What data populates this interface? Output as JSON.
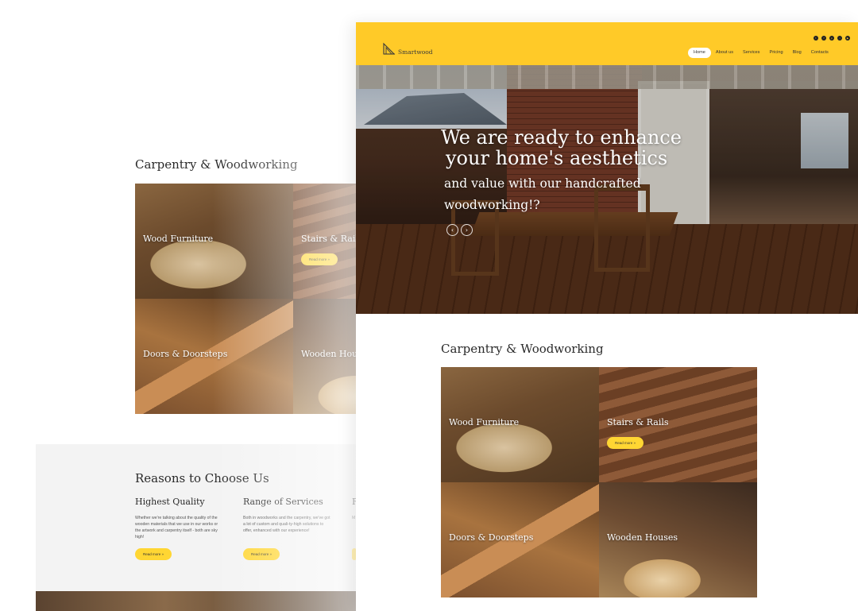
{
  "background_page": {
    "section_title": "Carpentry & Woodworking",
    "tiles": [
      {
        "label": "Wood Furniture"
      },
      {
        "label": "Stairs & Rail",
        "button": "Read more »"
      },
      {
        "label": "Doors & Doorsteps"
      },
      {
        "label": "Wooden Hou"
      }
    ],
    "reasons": {
      "title": "Reasons to Choose Us",
      "items": [
        {
          "heading": "Highest Quality",
          "text": "Whether we're talking about the quality of the wooden materials that we use in our works or the artwork and carpentry itself - both are sky high!",
          "button": "Read more »"
        },
        {
          "heading": "Range of Services",
          "text": "Both in woodworks and the carpentry, we've got a lot of custom and quali-ty-high solutions to offer, enhanced with our experience!",
          "button": "Read more »"
        },
        {
          "heading": "R",
          "text": "M",
          "button": ""
        }
      ]
    }
  },
  "header": {
    "brand": "Smartwood",
    "social_icons": [
      "twitter-icon",
      "facebook-icon",
      "pinterest-icon",
      "instagram-icon",
      "youtube-icon"
    ],
    "nav": [
      "Home",
      "About us",
      "Services",
      "Pricing",
      "Blog",
      "Contacts"
    ],
    "active_nav": "Home"
  },
  "hero": {
    "title_line1": "We are ready to enhance",
    "title_line2": "your home's aesthetics",
    "subtitle_line1": "and value with our handcrafted",
    "subtitle_line2": "woodworking!?",
    "prev_arrow": "‹",
    "next_arrow": "›"
  },
  "services": {
    "title": "Carpentry & Woodworking",
    "tiles": [
      {
        "label": "Wood Furniture"
      },
      {
        "label": "Stairs & Rails",
        "button": "Read more »"
      },
      {
        "label": "Doors & Doorsteps"
      },
      {
        "label": "Wooden Houses"
      }
    ]
  },
  "colors": {
    "accent": "#ffca28",
    "button": "#ffd633",
    "text_dark": "#2a2a2a"
  }
}
